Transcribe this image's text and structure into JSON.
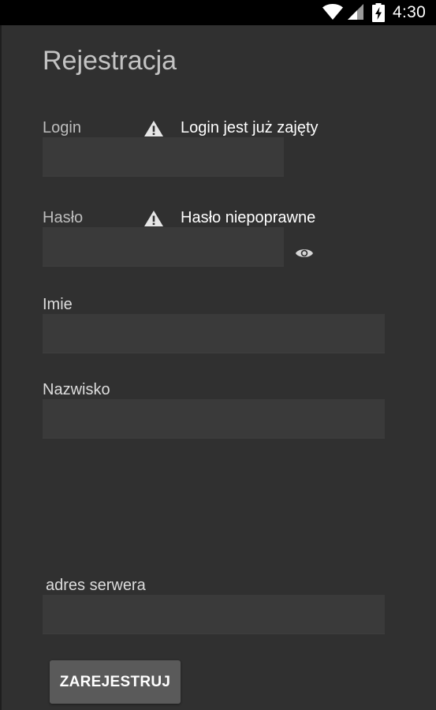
{
  "status_bar": {
    "time": "4:30",
    "icons": [
      "wifi-icon",
      "signal-icon",
      "battery-charging-icon"
    ]
  },
  "form": {
    "title": "Rejestracja",
    "login": {
      "label": "Login",
      "value": "",
      "error": "Login jest już zajęty"
    },
    "password": {
      "label": "Hasło",
      "value": "",
      "error": "Hasło niepoprawne",
      "toggle_icon": "eye-icon"
    },
    "first_name": {
      "label": "Imie",
      "value": ""
    },
    "last_name": {
      "label": "Nazwisko",
      "value": ""
    },
    "server": {
      "label": "adres serwera",
      "value": ""
    },
    "submit_label": "ZAREJESTRUJ",
    "error_icon": "warning-icon"
  },
  "colors": {
    "background": "#303030",
    "status_bar": "#000000",
    "input_background": "#3a3a3a",
    "button_background": "#5a5a5a",
    "label_text": "#bdbdbd",
    "error_text": "#ffffff"
  }
}
